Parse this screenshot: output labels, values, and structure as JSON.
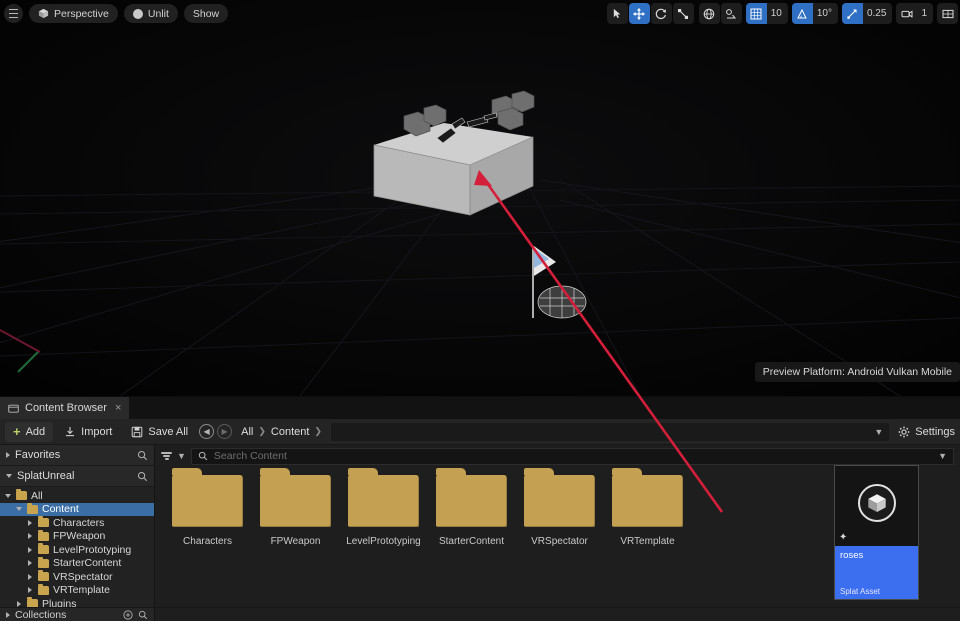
{
  "viewport": {
    "toolbar_left": {
      "menu_icon": "hamburger-icon",
      "perspective_label": "Perspective",
      "perspective_icon": "cube-icon",
      "lighting_label": "Unlit",
      "lighting_icon": "sphere-icon",
      "show_label": "Show"
    },
    "toolbar_right": {
      "select_icon": "cursor-select-icon",
      "translate_icon": "move-gizmo-icon",
      "rotate_icon": "rotate-gizmo-icon",
      "scale_icon": "scale-gizmo-icon",
      "coordinate_icon": "world-globe-icon",
      "surface_snap_icon": "surface-snap-icon",
      "grid_snap_icon": "grid-snap-icon",
      "grid_snap_value": "10",
      "angle_snap_icon": "angle-snap-icon",
      "angle_snap_value": "10°",
      "scale_snap_icon": "scale-snap-icon",
      "scale_snap_value": "0.25",
      "camera_speed_icon": "camera-icon",
      "camera_speed_value": "1",
      "maximize_icon": "maximize-viewport-icon"
    },
    "preview_platform": "Preview Platform:  Android Vulkan Mobile",
    "accent_blue": "#2f6fc4",
    "annotation_color": "#d41f3a"
  },
  "content_browser": {
    "tab": {
      "icon": "content-browser-icon",
      "label": "Content Browser",
      "close": "×"
    },
    "toolbar": {
      "add_label": "Add",
      "add_icon": "plus-icon",
      "import_label": "Import",
      "import_icon": "import-icon",
      "save_all_label": "Save All",
      "save_all_icon": "save-icon",
      "back_icon": "back-arrow-icon",
      "forward_icon": "forward-arrow-icon",
      "breadcrumb": [
        "All",
        "Content"
      ],
      "path_dropdown_icon": "chevron-down-icon",
      "settings_label": "Settings",
      "settings_icon": "gear-icon"
    },
    "sidebar": {
      "favorites": {
        "label": "Favorites",
        "expanded": false,
        "search_icon": "search-icon"
      },
      "project": {
        "label": "SplatUnreal",
        "expanded": true,
        "search_icon": "search-icon"
      },
      "tree": [
        {
          "label": "All",
          "depth": 0,
          "expanded": true,
          "selected": false
        },
        {
          "label": "Content",
          "depth": 1,
          "expanded": true,
          "selected": true
        },
        {
          "label": "Characters",
          "depth": 2,
          "expanded": false,
          "selected": false
        },
        {
          "label": "FPWeapon",
          "depth": 2,
          "expanded": false,
          "selected": false
        },
        {
          "label": "LevelPrototyping",
          "depth": 2,
          "expanded": false,
          "selected": false
        },
        {
          "label": "StarterContent",
          "depth": 2,
          "expanded": false,
          "selected": false
        },
        {
          "label": "VRSpectator",
          "depth": 2,
          "expanded": false,
          "selected": false
        },
        {
          "label": "VRTemplate",
          "depth": 2,
          "expanded": false,
          "selected": false
        },
        {
          "label": "Plugins",
          "depth": 1,
          "expanded": false,
          "selected": false
        }
      ],
      "collections": {
        "label": "Collections",
        "add_icon": "add-collection-icon",
        "search_icon": "search-icon"
      }
    },
    "filter_row": {
      "filter_icon": "filter-icon",
      "filter_chevron": "chevron-down-icon",
      "search_icon": "search-icon",
      "search_placeholder": "Search Content",
      "search_value": "",
      "view_options_icon": "chevron-down-icon"
    },
    "folders": [
      {
        "name": "Characters",
        "icon": "folder-icon"
      },
      {
        "name": "FPWeapon",
        "icon": "folder-icon"
      },
      {
        "name": "LevelPrototyping",
        "icon": "folder-icon"
      },
      {
        "name": "StarterContent",
        "icon": "folder-icon"
      },
      {
        "name": "VRSpectator",
        "icon": "folder-icon"
      },
      {
        "name": "VRTemplate",
        "icon": "folder-icon"
      }
    ],
    "selected_asset": {
      "name": "roses",
      "type": "Splat Asset",
      "thumbnail_icon": "cube-asset-icon",
      "favorite_icon": "star-icon",
      "selected": true,
      "selection_color": "#3c6ef0"
    },
    "folder_color": "#c3a052"
  }
}
